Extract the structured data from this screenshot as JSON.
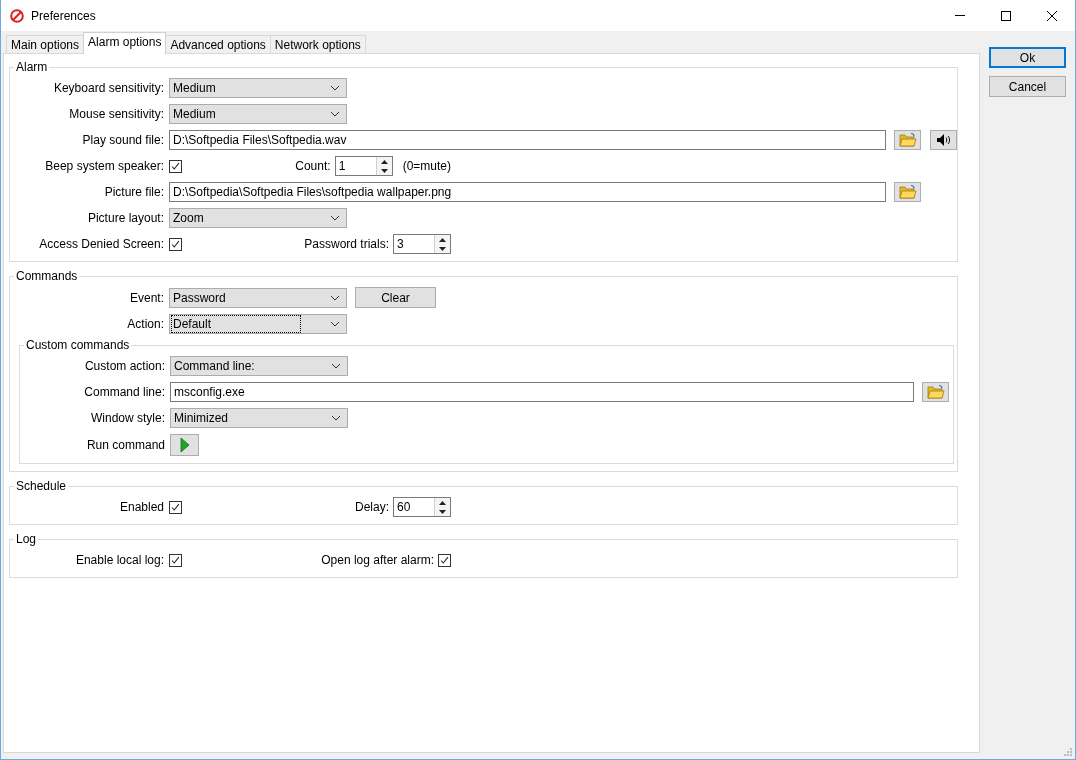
{
  "window": {
    "title": "Preferences"
  },
  "tabs": [
    {
      "label": "Main options",
      "selected": false
    },
    {
      "label": "Alarm options",
      "selected": true
    },
    {
      "label": "Advanced options",
      "selected": false
    },
    {
      "label": "Network options",
      "selected": false
    }
  ],
  "groups": [
    {
      "title": "Alarm",
      "rows": [
        {
          "kind": "select",
          "label": "Keyboard sensitivity:",
          "value": "Medium"
        },
        {
          "kind": "select",
          "label": "Mouse sensitivity:",
          "value": "Medium"
        },
        {
          "kind": "file",
          "label": "Play sound file:",
          "value": "D:\\Softpedia Files\\Softpedia.wav",
          "buttons": [
            {
              "kind": "folder"
            },
            {
              "kind": "speaker"
            }
          ]
        },
        {
          "kind": "check",
          "label": "Beep system speaker:",
          "checked": true,
          "side": {
            "kind": "spinner",
            "label": "Count:",
            "value": "1",
            "note": "(0=mute)"
          }
        },
        {
          "kind": "file",
          "label": "Picture file:",
          "value": "D:\\Softpedia\\Softpedia Files\\softpedia wallpaper.png",
          "buttons": [
            {
              "kind": "folder"
            }
          ]
        },
        {
          "kind": "select",
          "label": "Picture layout:",
          "value": "Zoom"
        },
        {
          "kind": "check",
          "label": "Access Denied Screen:",
          "checked": true,
          "side": {
            "kind": "spinner",
            "label": "Password trials:",
            "value": "3"
          }
        }
      ]
    },
    {
      "title": "Commands",
      "rows": [
        {
          "kind": "select",
          "label": "Event:",
          "value": "Password",
          "side": {
            "kind": "button",
            "label": "Clear"
          }
        },
        {
          "kind": "select",
          "label": "Action:",
          "value": "Default",
          "focused": true
        }
      ],
      "subgroup": {
        "title": "Custom commands",
        "rows": [
          {
            "kind": "select",
            "label": "Custom action:",
            "value": "Command line:"
          },
          {
            "kind": "file",
            "label": "Command line:",
            "value": "msconfig.exe",
            "buttons": [
              {
                "kind": "folder"
              }
            ]
          },
          {
            "kind": "select",
            "label": "Window style:",
            "value": "Minimized"
          },
          {
            "kind": "run",
            "label": "Run command"
          }
        ]
      }
    },
    {
      "title": "Schedule",
      "rows": [
        {
          "kind": "check",
          "label": "Enabled",
          "checked": true,
          "side": {
            "kind": "spinner",
            "label": "Delay:",
            "value": "60"
          }
        }
      ]
    },
    {
      "title": "Log",
      "rows": [
        {
          "kind": "check",
          "label": "Enable local log:",
          "checked": true,
          "side": {
            "kind": "check",
            "label": "Open log after alarm:",
            "checked": true
          }
        }
      ]
    }
  ],
  "buttons": [
    {
      "label": "Ok",
      "default": true
    },
    {
      "label": "Cancel",
      "default": false
    }
  ]
}
